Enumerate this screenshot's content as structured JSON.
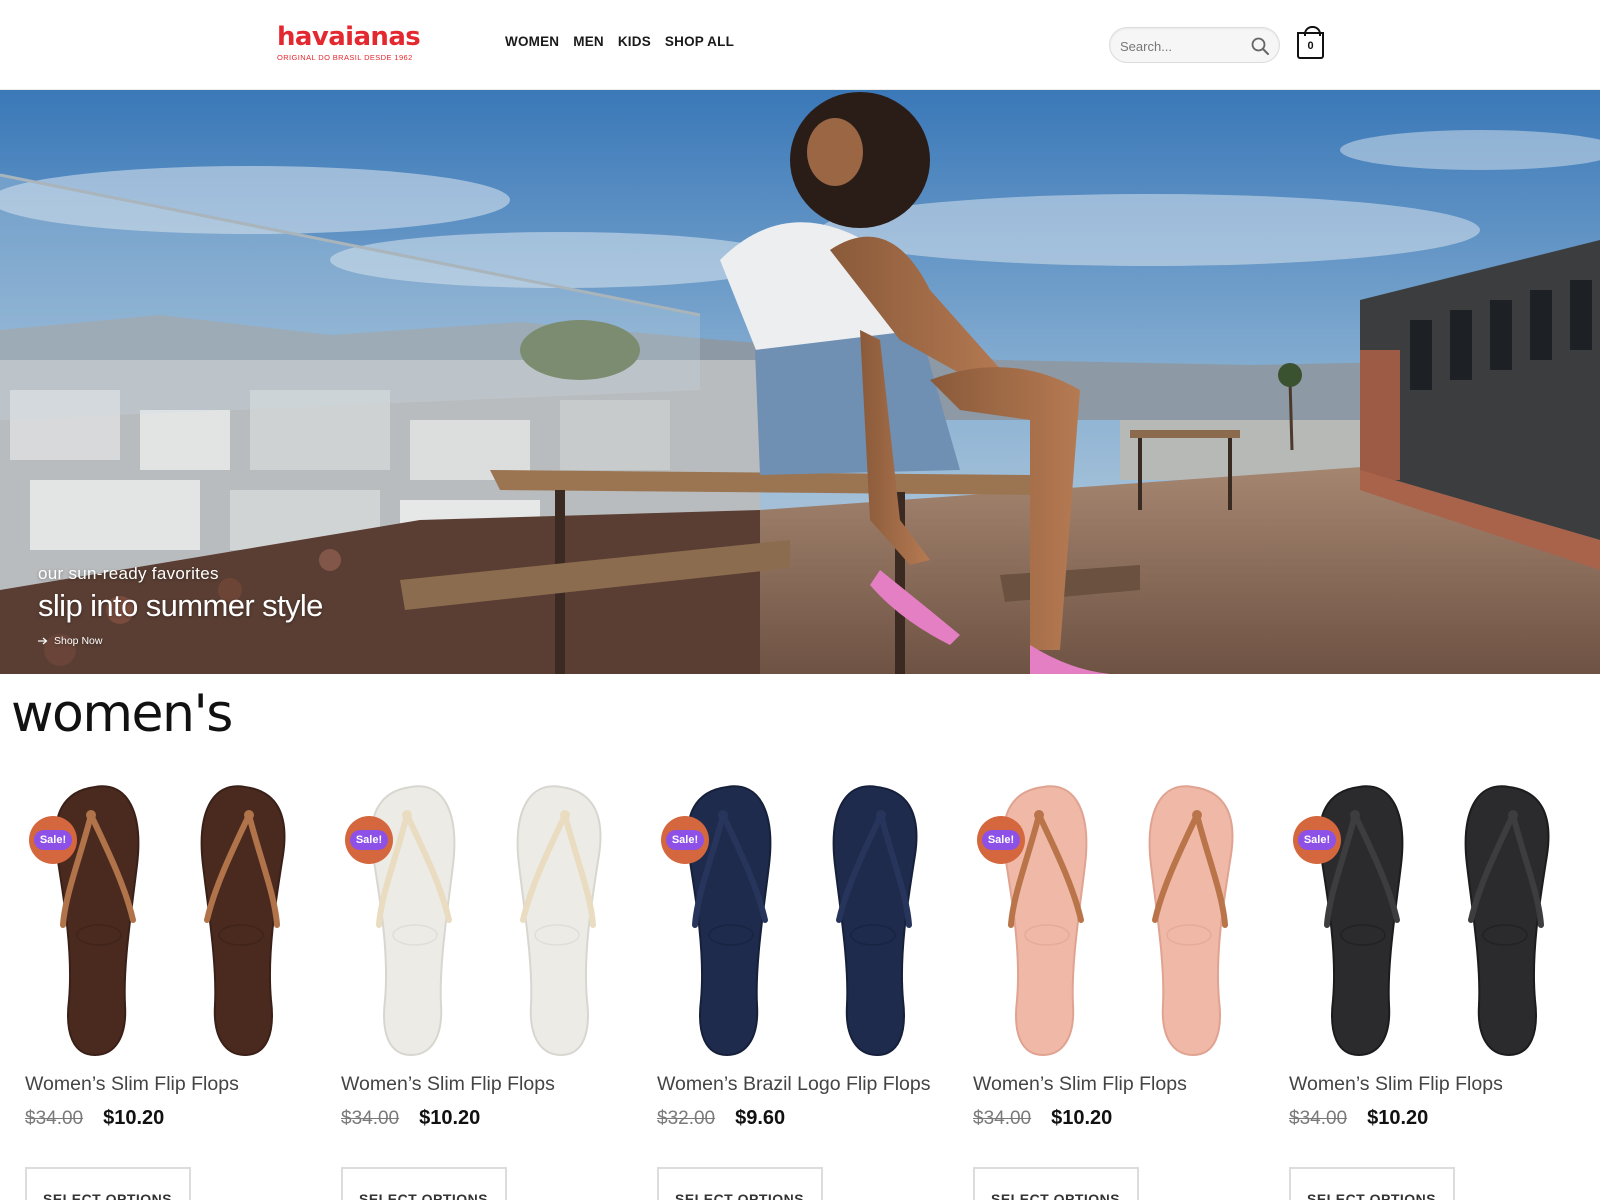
{
  "header": {
    "logo_text": "havaianas",
    "logo_tagline": "ORIGINAL DO BRASIL DESDE 1962",
    "nav": [
      {
        "label": "WOMEN"
      },
      {
        "label": "MEN"
      },
      {
        "label": "KIDS"
      },
      {
        "label": "SHOP ALL"
      }
    ],
    "search": {
      "placeholder": "Search...",
      "value": ""
    },
    "cart_count": "0"
  },
  "hero": {
    "kicker": "our sun-ready favorites",
    "headline": "slip into summer style",
    "cta": "Shop Now"
  },
  "section": {
    "title": "women's"
  },
  "colors": {
    "brand": "#e4282f",
    "sale_badge": "#8d51e8",
    "sale_ring": "#d4673d"
  },
  "products": [
    {
      "name": "Women’s Slim Flip Flops",
      "old_price": "$34.00",
      "price": "$10.20",
      "badge": "Sale!",
      "button": "SELECT OPTIONS",
      "color": "brown"
    },
    {
      "name": "Women’s Slim Flip Flops",
      "old_price": "$34.00",
      "price": "$10.20",
      "badge": "Sale!",
      "button": "SELECT OPTIONS",
      "color": "white"
    },
    {
      "name": "Women’s Brazil Logo Flip Flops",
      "old_price": "$32.00",
      "price": "$9.60",
      "badge": "Sale!",
      "button": "SELECT OPTIONS",
      "color": "navy"
    },
    {
      "name": "Women’s Slim Flip Flops",
      "old_price": "$34.00",
      "price": "$10.20",
      "badge": "Sale!",
      "button": "SELECT OPTIONS",
      "color": "pink"
    },
    {
      "name": "Women’s Slim Flip Flops",
      "old_price": "$34.00",
      "price": "$10.20",
      "badge": "Sale!",
      "button": "SELECT OPTIONS",
      "color": "black"
    }
  ]
}
